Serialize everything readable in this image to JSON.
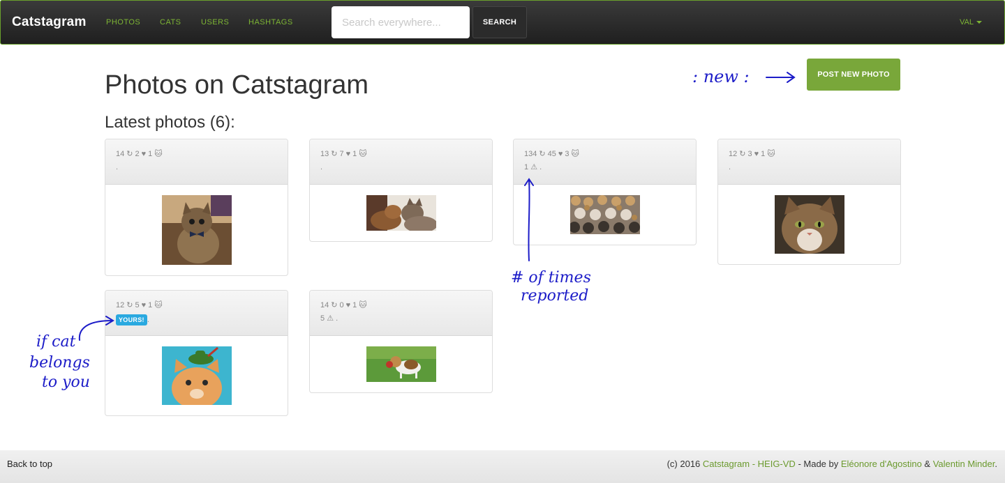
{
  "navbar": {
    "brand": "Catstagram",
    "links": [
      "PHOTOS",
      "CATS",
      "USERS",
      "HASHTAGS"
    ],
    "search_placeholder": "Search everywhere...",
    "search_button": "SEARCH",
    "user": "VAL"
  },
  "header": {
    "title": "Photos on Catstagram",
    "subtitle": "Latest photos (6):",
    "post_button": "POST NEW PHOTO"
  },
  "photos": [
    {
      "views": "14",
      "shares": "2",
      "likes": "1",
      "line2": ".",
      "image": "kitten-bowtie"
    },
    {
      "views": "13",
      "shares": "7",
      "likes": "1",
      "line2": ".",
      "image": "two-cats"
    },
    {
      "views": "134",
      "shares": "45",
      "likes": "3",
      "reports": "1",
      "line2": ".",
      "image": "cat-crowd"
    },
    {
      "views": "12",
      "shares": "3",
      "likes": "1",
      "line2": ".",
      "image": "tabby-portrait"
    },
    {
      "views": "12",
      "shares": "5",
      "likes": "1",
      "badge": "YOURS!",
      "line2": ".",
      "image": "cat-hat"
    },
    {
      "views": "14",
      "shares": "0",
      "likes": "1",
      "reports": "5",
      "line2": ".",
      "image": "beagle-puppy"
    }
  ],
  "icons": {
    "shares": "↻",
    "likes": "♥",
    "cat": "🐱",
    "report": "⚠"
  },
  "annotations": {
    "new": ": new :",
    "reported_1": "# of times",
    "reported_2": "reported",
    "yours_1": "if cat",
    "yours_2": "belongs",
    "yours_3": "to you"
  },
  "footer": {
    "back_to_top": "Back to top",
    "prefix": "(c) 2016 ",
    "site": "Catstagram - HEIG-VD",
    "made_by": " - Made by ",
    "author1": "Eléonore d'Agostino",
    "amp": " & ",
    "author2": "Valentin Minder",
    "end": "."
  },
  "colors": {
    "accent": "#79a73a",
    "badge": "#2aa9e0",
    "annotation": "#1c1cc8"
  }
}
